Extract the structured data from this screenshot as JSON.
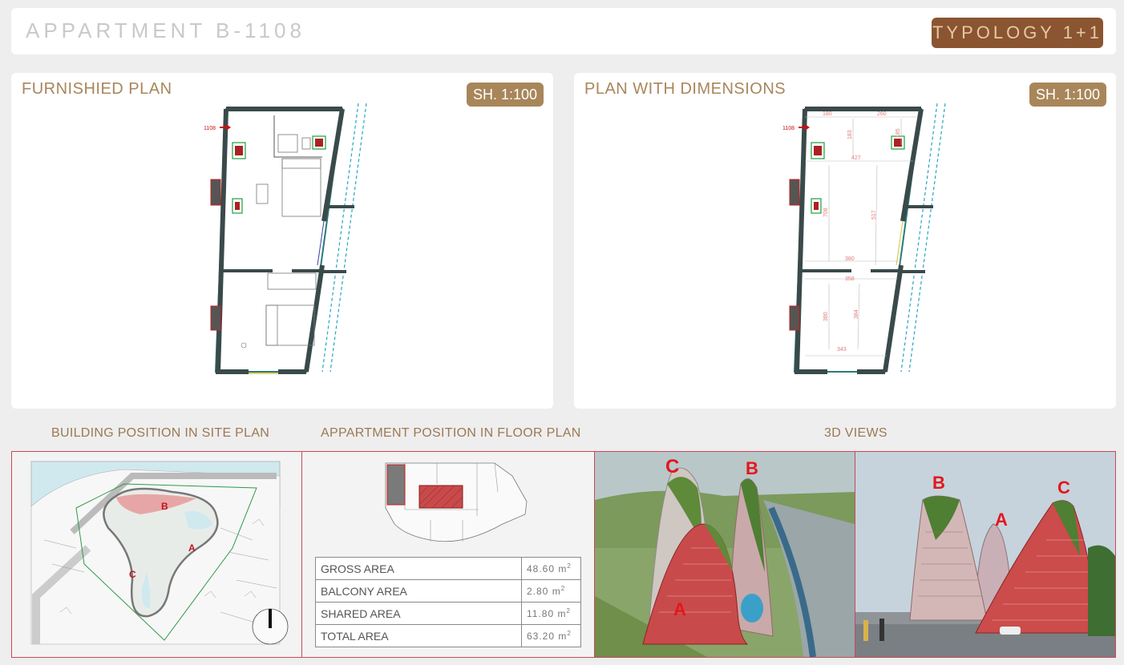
{
  "header": {
    "title": "APPARTMENT B-1108",
    "typology": "TYPOLOGY 1+1"
  },
  "furnished_plan": {
    "title": "FURNISHIED PLAN",
    "scale": "SH. 1:100",
    "unit_marker": "1108"
  },
  "dimension_plan": {
    "title": "PLAN WITH DIMENSIONS",
    "scale": "SH. 1:100",
    "unit_marker": "1108",
    "dimensions": [
      "180",
      "260",
      "183",
      "185",
      "427",
      "708",
      "517",
      "380",
      "358",
      "380",
      "384",
      "343"
    ]
  },
  "site_plan": {
    "heading": "BUILDING POSITION IN SITE PLAN",
    "labels": [
      "B",
      "A",
      "C"
    ]
  },
  "floor_plan": {
    "heading": "APPARTMENT POSITION IN FLOOR PLAN",
    "areas": [
      {
        "label": "GROSS AREA",
        "value": "48.60",
        "unit": "m"
      },
      {
        "label": "BALCONY AREA",
        "value": "2.80",
        "unit": "m"
      },
      {
        "label": "SHARED AREA",
        "value": "11.80",
        "unit": "m"
      },
      {
        "label": "TOTAL AREA",
        "value": "63.20",
        "unit": "m"
      }
    ]
  },
  "views": {
    "heading": "3D VIEWS",
    "view1_labels": [
      "C",
      "B",
      "A"
    ],
    "view2_labels": [
      "B",
      "A",
      "C"
    ]
  },
  "colors": {
    "accent_gold": "#a8865a",
    "typology_brown": "#8a5530",
    "label_red": "#e2171d",
    "frame_red": "#c9485a"
  }
}
